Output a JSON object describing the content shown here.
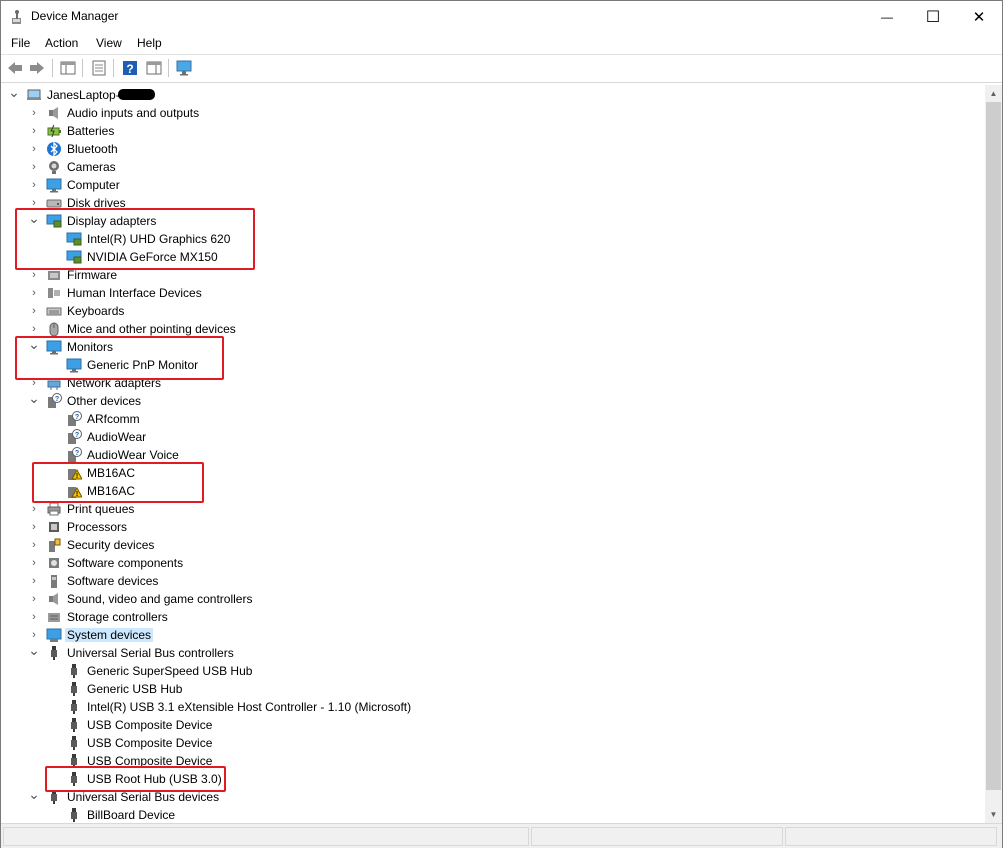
{
  "window": {
    "title": "Device Manager",
    "controls": {
      "minimize": "—",
      "maximize": "☐",
      "close": "✕"
    }
  },
  "menu": [
    "File",
    "Action",
    "View",
    "Help"
  ],
  "toolbar": {
    "buttons": [
      "back-icon",
      "forward-icon",
      "show-hide-console-tree-icon",
      "properties-icon",
      "help-icon",
      "action-pane-icon",
      "monitor-scan-icon"
    ]
  },
  "tree": {
    "root": "JanesLaptop-",
    "items": [
      {
        "label": "Audio inputs and outputs",
        "icon": "speaker-icon",
        "state": "collapsed"
      },
      {
        "label": "Batteries",
        "icon": "battery-icon",
        "state": "collapsed"
      },
      {
        "label": "Bluetooth",
        "icon": "bluetooth-icon",
        "state": "collapsed"
      },
      {
        "label": "Cameras",
        "icon": "camera-icon",
        "state": "collapsed"
      },
      {
        "label": "Computer",
        "icon": "computer-icon",
        "state": "collapsed"
      },
      {
        "label": "Disk drives",
        "icon": "disk-drive-icon",
        "state": "collapsed"
      },
      {
        "label": "Display adapters",
        "icon": "display-adapter-icon",
        "state": "expanded",
        "children": [
          {
            "label": "Intel(R) UHD Graphics 620",
            "icon": "display-adapter-icon"
          },
          {
            "label": "NVIDIA GeForce MX150",
            "icon": "display-adapter-icon"
          }
        ]
      },
      {
        "label": "Firmware",
        "icon": "firmware-icon",
        "state": "collapsed"
      },
      {
        "label": "Human Interface Devices",
        "icon": "hid-icon",
        "state": "collapsed"
      },
      {
        "label": "Keyboards",
        "icon": "keyboard-icon",
        "state": "collapsed"
      },
      {
        "label": "Mice and other pointing devices",
        "icon": "mouse-icon",
        "state": "collapsed"
      },
      {
        "label": "Monitors",
        "icon": "monitor-icon",
        "state": "expanded",
        "children": [
          {
            "label": "Generic PnP Monitor",
            "icon": "monitor-icon"
          }
        ]
      },
      {
        "label": "Network adapters",
        "icon": "network-icon",
        "state": "collapsed"
      },
      {
        "label": "Other devices",
        "icon": "unknown-device-icon",
        "state": "expanded",
        "children": [
          {
            "label": "ARfcomm",
            "icon": "unknown-device-icon"
          },
          {
            "label": "AudioWear",
            "icon": "unknown-device-icon"
          },
          {
            "label": "AudioWear Voice",
            "icon": "unknown-device-icon"
          },
          {
            "label": "MB16AC",
            "icon": "warning-device-icon"
          },
          {
            "label": "MB16AC",
            "icon": "warning-device-icon"
          }
        ]
      },
      {
        "label": "Print queues",
        "icon": "printer-icon",
        "state": "collapsed"
      },
      {
        "label": "Processors",
        "icon": "processor-icon",
        "state": "collapsed"
      },
      {
        "label": "Security devices",
        "icon": "security-device-icon",
        "state": "collapsed"
      },
      {
        "label": "Software components",
        "icon": "software-component-icon",
        "state": "collapsed"
      },
      {
        "label": "Software devices",
        "icon": "software-device-icon",
        "state": "collapsed"
      },
      {
        "label": "Sound, video and game controllers",
        "icon": "speaker-icon",
        "state": "collapsed"
      },
      {
        "label": "Storage controllers",
        "icon": "storage-controller-icon",
        "state": "collapsed"
      },
      {
        "label": "System devices",
        "icon": "system-device-icon",
        "state": "collapsed",
        "selected": true
      },
      {
        "label": "Universal Serial Bus controllers",
        "icon": "usb-icon",
        "state": "expanded",
        "children": [
          {
            "label": "Generic SuperSpeed USB Hub",
            "icon": "usb-icon"
          },
          {
            "label": "Generic USB Hub",
            "icon": "usb-icon"
          },
          {
            "label": "Intel(R) USB 3.1 eXtensible Host Controller - 1.10 (Microsoft)",
            "icon": "usb-icon"
          },
          {
            "label": "USB Composite Device",
            "icon": "usb-icon"
          },
          {
            "label": "USB Composite Device",
            "icon": "usb-icon"
          },
          {
            "label": "USB Composite Device",
            "icon": "usb-icon"
          },
          {
            "label": "USB Root Hub (USB 3.0)",
            "icon": "usb-icon"
          }
        ]
      },
      {
        "label": "Universal Serial Bus devices",
        "icon": "usb-icon",
        "state": "expanded",
        "children": [
          {
            "label": "BillBoard Device",
            "icon": "usb-icon"
          }
        ]
      }
    ]
  },
  "colors": {
    "selection": "#cce8ff",
    "highlight_box": "#e01b24",
    "warning": "#f5c400",
    "monitor_blue": "#1e90d6"
  }
}
